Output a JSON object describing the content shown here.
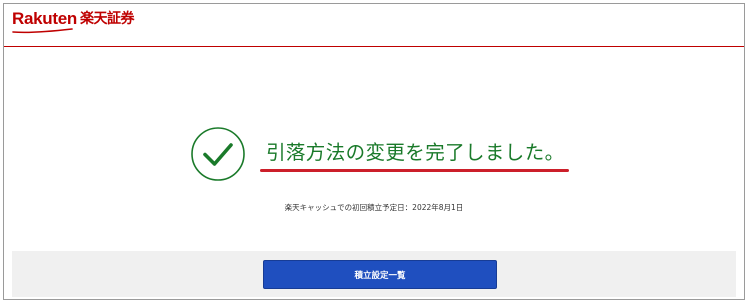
{
  "header": {
    "logo_en": "Rakuten",
    "logo_ja": "楽天証券"
  },
  "result": {
    "icon": "check-circle-icon",
    "message": "引落方法の変更を完了しました。",
    "info_label": "楽天キャッシュでの初回積立予定日：",
    "info_value": "2022年8月1日"
  },
  "footer": {
    "button_label": "積立設定一覧"
  },
  "colors": {
    "brand_red": "#bf0000",
    "success_green": "#1a7a2a",
    "underline_red": "#cc1f2a",
    "button_blue": "#1f4fbf",
    "footer_bg": "#f0f0f0"
  }
}
